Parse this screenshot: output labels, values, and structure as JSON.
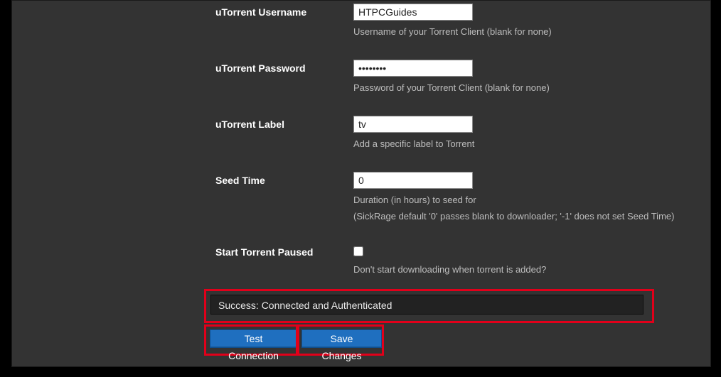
{
  "fields": {
    "username": {
      "label": "uTorrent Username",
      "value": "HTPCGuides",
      "help": "Username of your Torrent Client (blank for none)"
    },
    "password": {
      "label": "uTorrent Password",
      "value": "••••••••",
      "help": "Password of your Torrent Client (blank for none)"
    },
    "labelField": {
      "label": "uTorrent Label",
      "value": "tv",
      "help": "Add a specific label to Torrent"
    },
    "seedTime": {
      "label": "Seed Time",
      "value": "0",
      "help": "Duration (in hours) to seed for",
      "help2": "(SickRage default '0' passes blank to downloader; '-1' does not set Seed Time)"
    },
    "paused": {
      "label": "Start Torrent Paused",
      "help": "Don't start downloading when torrent is added?"
    }
  },
  "status": "Success: Connected and Authenticated",
  "buttons": {
    "test": "Test Connection",
    "save": "Save Changes"
  }
}
